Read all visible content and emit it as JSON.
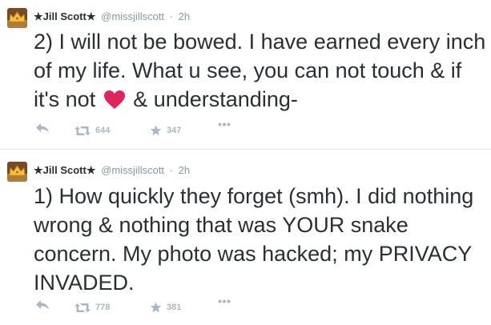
{
  "colors": {
    "text": "#292f33",
    "secondary": "#8899a6",
    "action_icon": "#aab8c2",
    "heart": "#e0245e",
    "divider": "#e1e8ed"
  },
  "tweets": [
    {
      "fullname": "★Jill Scott★",
      "username": "@missjillscott",
      "separator": "·",
      "time": "2h",
      "text_before_emoji": "2) I will not be bowed. I have earned every inch of my life. What u see, you can not touch & if it's not ",
      "emoji": "red-heart",
      "text_after_emoji": " & understanding-",
      "retweet_count": "644",
      "favorite_count": "347",
      "icons": [
        "reply-icon",
        "retweet-icon",
        "favorite-star-icon",
        "more-dots-icon"
      ]
    },
    {
      "fullname": "★Jill Scott★",
      "username": "@missjillscott",
      "separator": "·",
      "time": "2h",
      "text": "1) How quickly they forget (smh). I did nothing wrong & nothing that was YOUR snake concern. My photo was hacked; my PRIVACY INVADED.",
      "retweet_count": "778",
      "favorite_count": "381",
      "icons": [
        "reply-icon",
        "retweet-icon",
        "favorite-star-icon",
        "more-dots-icon"
      ]
    }
  ]
}
